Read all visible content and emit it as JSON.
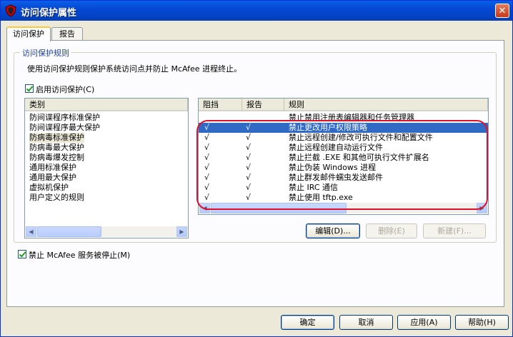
{
  "window": {
    "title": "访问保护属性",
    "close_label": "✕"
  },
  "tabs": [
    {
      "label": "访问保护",
      "active": true
    },
    {
      "label": "报告",
      "active": false
    }
  ],
  "group": {
    "title": "访问保护规则",
    "description": "使用访问保护规则保护系统访问点并防止 McAfee 进程终止。"
  },
  "enable_checkbox": {
    "label": "启用访问保护(C)",
    "checked": true
  },
  "categories": {
    "header": "类别",
    "items": [
      "防间谍程序标准保护",
      "防间谍程序最大保护",
      "防病毒标准保护",
      "防病毒最大保护",
      "防病毒爆发控制",
      "通用标准保护",
      "通用最大保护",
      "虚拟机保护",
      "用户定义的规则"
    ],
    "selected_index": 2
  },
  "rules": {
    "headers": {
      "block": "阻挡",
      "report": "报告",
      "rule": "规则"
    },
    "rows": [
      {
        "block": "",
        "report": "",
        "rule": "禁止禁用注册表编辑器和任务管理器"
      },
      {
        "block": "√",
        "report": "√",
        "rule": "禁止更改用户权限策略"
      },
      {
        "block": "√",
        "report": "√",
        "rule": "禁止远程创建/修改可执行文件和配置文件"
      },
      {
        "block": "√",
        "report": "√",
        "rule": "禁止远程创建自动运行文件"
      },
      {
        "block": "√",
        "report": "√",
        "rule": "禁止拦截 .EXE 和其他可执行文件扩展名"
      },
      {
        "block": "√",
        "report": "√",
        "rule": "禁止伪装 Windows 进程"
      },
      {
        "block": "√",
        "report": "√",
        "rule": "禁止群发邮件蠕虫发送邮件"
      },
      {
        "block": "√",
        "report": "√",
        "rule": "禁止 IRC 通信"
      },
      {
        "block": "√",
        "report": "√",
        "rule": "禁止使用 tftp.exe"
      }
    ],
    "selected_index": 1
  },
  "rule_buttons": {
    "edit": "编辑(D)...",
    "delete": "删除(E)",
    "new": "新建(F)..."
  },
  "stop_checkbox": {
    "label": "禁止 McAfee 服务被停止(M)",
    "checked": true
  },
  "footer_buttons": {
    "ok": "确定",
    "cancel": "取消",
    "apply": "应用(A)",
    "help": "帮助(H)"
  },
  "colors": {
    "title_bar": "#0548d4",
    "selection": "#316ac5",
    "annotation": "#e0102a"
  }
}
